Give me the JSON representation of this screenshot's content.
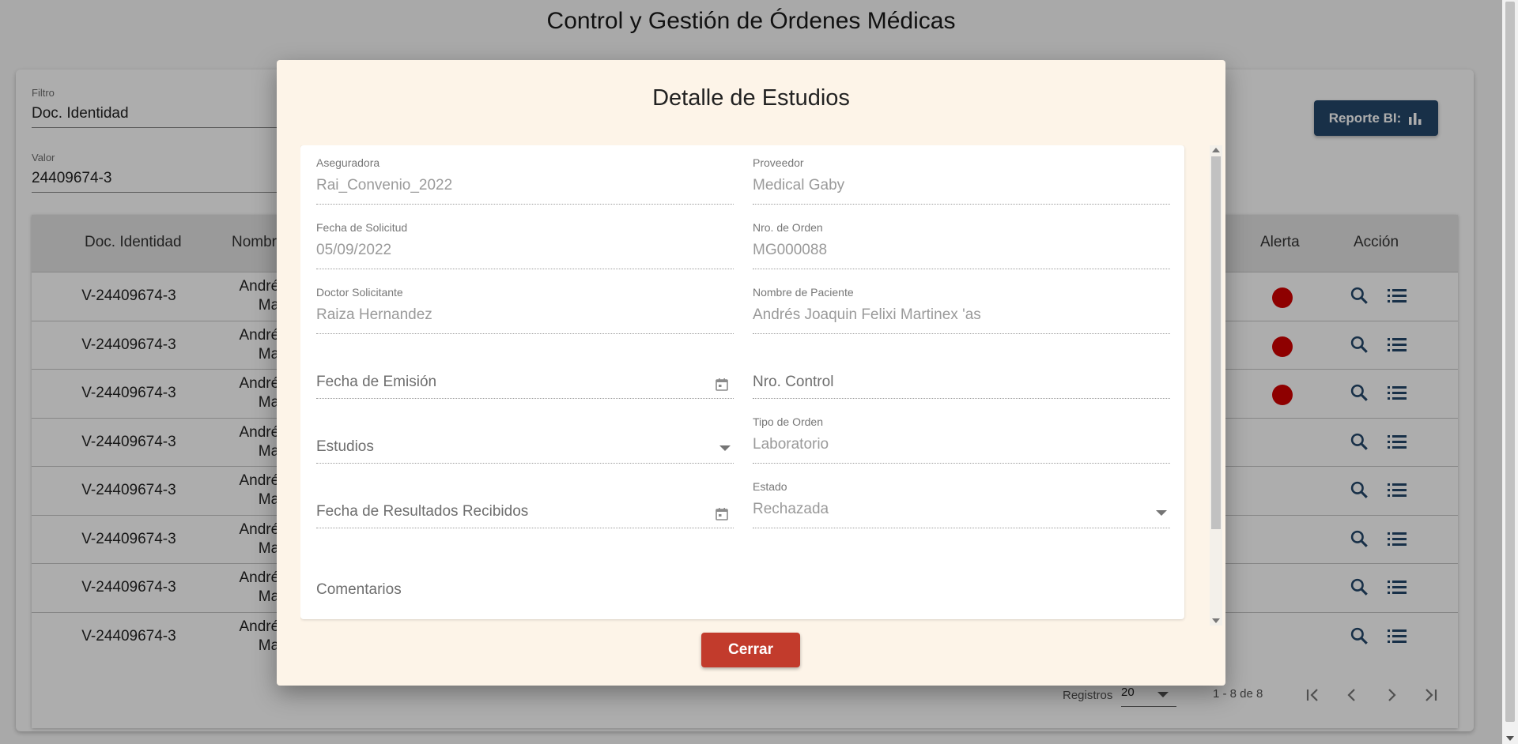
{
  "page": {
    "title": "Control y Gestión de Órdenes Médicas"
  },
  "filters": {
    "filter_label": "Filtro",
    "filter_value": "Doc. Identidad",
    "value_label": "Valor",
    "value_value": "24409674-3"
  },
  "report_button": {
    "label": "Reporte BI:",
    "icon": "bar-chart-icon"
  },
  "table": {
    "headers": {
      "doc": "Doc. Identidad",
      "name": "Nombr",
      "alert": "Alerta",
      "action": "Acción"
    },
    "rows": [
      {
        "doc": "V-24409674-3",
        "name1": "Andrés J",
        "name2": "Ma",
        "alert": true
      },
      {
        "doc": "V-24409674-3",
        "name1": "Andrés J",
        "name2": "Ma",
        "alert": true
      },
      {
        "doc": "V-24409674-3",
        "name1": "Andrés J",
        "name2": "Ma",
        "alert": true
      },
      {
        "doc": "V-24409674-3",
        "name1": "Andrés J",
        "name2": "Ma",
        "alert": false
      },
      {
        "doc": "V-24409674-3",
        "name1": "Andrés J",
        "name2": "Ma",
        "alert": false
      },
      {
        "doc": "V-24409674-3",
        "name1": "Andrés J",
        "name2": "Ma",
        "alert": false
      },
      {
        "doc": "V-24409674-3",
        "name1": "Andrés J",
        "name2": "Ma",
        "alert": false
      },
      {
        "doc": "V-24409674-3",
        "name1": "Andrés J",
        "name2": "Ma",
        "alert": false
      }
    ],
    "alert_color": "#d10000",
    "action_color": "#24476b"
  },
  "paginator": {
    "label": "Registros",
    "page_size": "20",
    "range": "1 - 8 de 8"
  },
  "modal": {
    "title": "Detalle de Estudios",
    "fields": {
      "aseguradora": {
        "label": "Aseguradora",
        "value": "Rai_Convenio_2022"
      },
      "proveedor": {
        "label": "Proveedor",
        "value": "Medical Gaby"
      },
      "fecha_solicitud": {
        "label": "Fecha de Solicitud",
        "value": "05/09/2022"
      },
      "nro_orden": {
        "label": "Nro. de Orden",
        "value": "MG000088"
      },
      "doctor": {
        "label": "Doctor Solicitante",
        "value": "Raiza Hernandez"
      },
      "paciente": {
        "label": "Nombre de Paciente",
        "value": "Andrés Joaquin Felixi Martinex 'as"
      },
      "fecha_emision": {
        "placeholder": "Fecha de Emisión"
      },
      "nro_control": {
        "placeholder": "Nro. Control"
      },
      "estudios": {
        "placeholder": "Estudios"
      },
      "tipo_orden": {
        "label": "Tipo de Orden",
        "value": "Laboratorio"
      },
      "fecha_resultados": {
        "placeholder": "Fecha de Resultados Recibidos"
      },
      "estado": {
        "label": "Estado",
        "value": "Rechazada"
      },
      "comentarios": {
        "placeholder": "Comentarios"
      }
    },
    "close_label": "Cerrar",
    "close_color": "#c23b2c",
    "background": "#fdf4e8"
  }
}
